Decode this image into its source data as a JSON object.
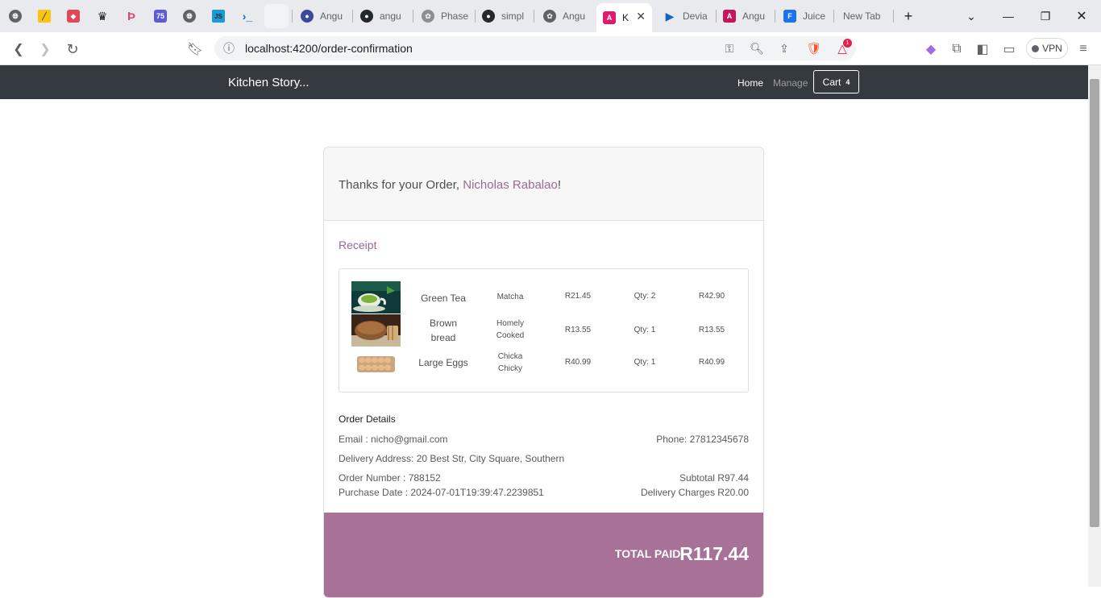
{
  "browser": {
    "tabs": [
      {
        "label": "Angu",
        "icon": "angular-icon"
      },
      {
        "label": "angu",
        "icon": "github-icon"
      },
      {
        "label": "Phase",
        "icon": "openai-icon"
      },
      {
        "label": "simpl",
        "icon": "github-icon"
      },
      {
        "label": "Angu",
        "icon": "openai-icon"
      },
      {
        "label": "K",
        "icon": "angular-icon"
      },
      {
        "label": "Devia",
        "icon": "azure-icon"
      },
      {
        "label": "Angu",
        "icon": "angular-icon"
      },
      {
        "label": "Juice",
        "icon": "doc-icon"
      },
      {
        "label": "New Tab",
        "icon": ""
      }
    ],
    "pinned_badge": "75",
    "url": "localhost:4200/order-confirmation",
    "vpn_label": "VPN",
    "notification_count": "1"
  },
  "nav": {
    "brand": "Kitchen Story...",
    "home": "Home",
    "manage": "Manage",
    "cart": "Cart",
    "cart_count": "4"
  },
  "order": {
    "thanks_prefix": "Thanks for your Order, ",
    "customer": "Nicholas Rabalao",
    "thanks_suffix": "!",
    "receipt_title": "Receipt",
    "items": [
      {
        "name": "Green Tea",
        "category": "Matcha",
        "price": "R21.45",
        "qty": "Qty: 2",
        "total": "R42.90"
      },
      {
        "name": "Brown bread",
        "category": "Homely Cooked",
        "price": "R13.55",
        "qty": "Qty: 1",
        "total": "R13.55"
      },
      {
        "name": "Large Eggs",
        "category": "Chicka Chicky",
        "price": "R40.99",
        "qty": "Qty: 1",
        "total": "R40.99"
      }
    ],
    "details_title": "Order Details",
    "email": "Email : nicho@gmail.com",
    "phone": "Phone: 27812345678",
    "address": "Delivery Address: 20 Best Str, City Square, Southern",
    "order_number": "Order Number : 788152",
    "purchase_date": "Purchase Date : 2024-07-01T19:39:47.2239851",
    "subtotal": "Subtotal R97.44",
    "delivery": "Delivery Charges R20.00",
    "total_label": "TOTAL PAID:",
    "total_value": "R117.44"
  },
  "colors": {
    "accent": "#a87197",
    "navbar": "#343a40"
  }
}
